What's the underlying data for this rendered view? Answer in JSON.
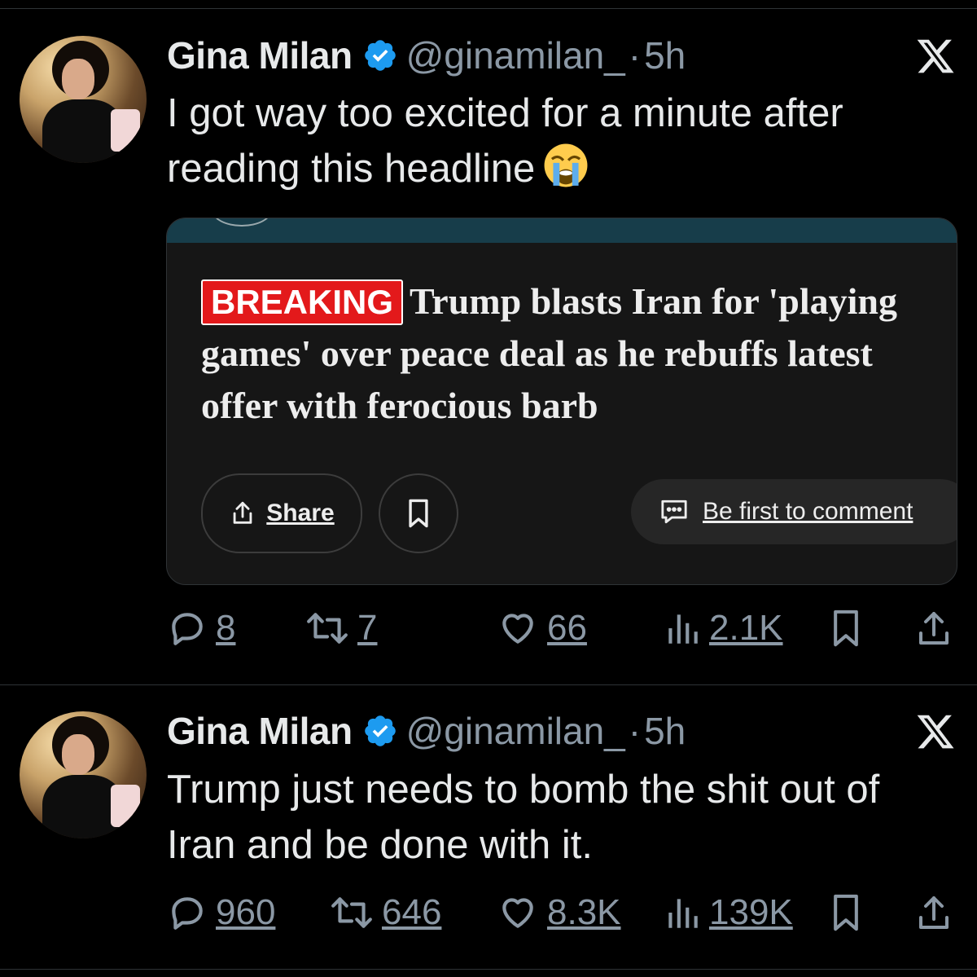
{
  "tweets": [
    {
      "author": {
        "name": "Gina Milan",
        "handle": "@ginamilan_",
        "verified": true
      },
      "dot": "·",
      "time": "5h",
      "text": "I got way too excited for a minute after reading this headline",
      "emoji": "loudly-crying-face",
      "card": {
        "badge": "BREAKING",
        "headline": "Trump blasts Iran for 'playing games' over peace deal as he rebuffs latest offer with ferocious barb",
        "share_label": "Share",
        "comment_label": "Be first to comment"
      },
      "stats": {
        "replies": "8",
        "reposts": "7",
        "likes": "66",
        "views": "2.1K"
      }
    },
    {
      "author": {
        "name": "Gina Milan",
        "handle": "@ginamilan_",
        "verified": true
      },
      "dot": "·",
      "time": "5h",
      "text_line1": "Trump just needs to bomb the shit out of",
      "text_line2": "Iran and be done with it.",
      "stats": {
        "replies": "960",
        "reposts": "646",
        "likes": "8.3K",
        "views": "139K"
      }
    }
  ],
  "colors": {
    "background": "#000000",
    "text": "#e7e9ea",
    "muted": "#8b98a5",
    "verified": "#1d9bf0",
    "breaking": "#e3191b"
  },
  "icons": [
    "verified-badge-icon",
    "x-logo-icon",
    "reply-icon",
    "repost-icon",
    "like-icon",
    "views-icon",
    "bookmark-icon",
    "share-icon"
  ]
}
